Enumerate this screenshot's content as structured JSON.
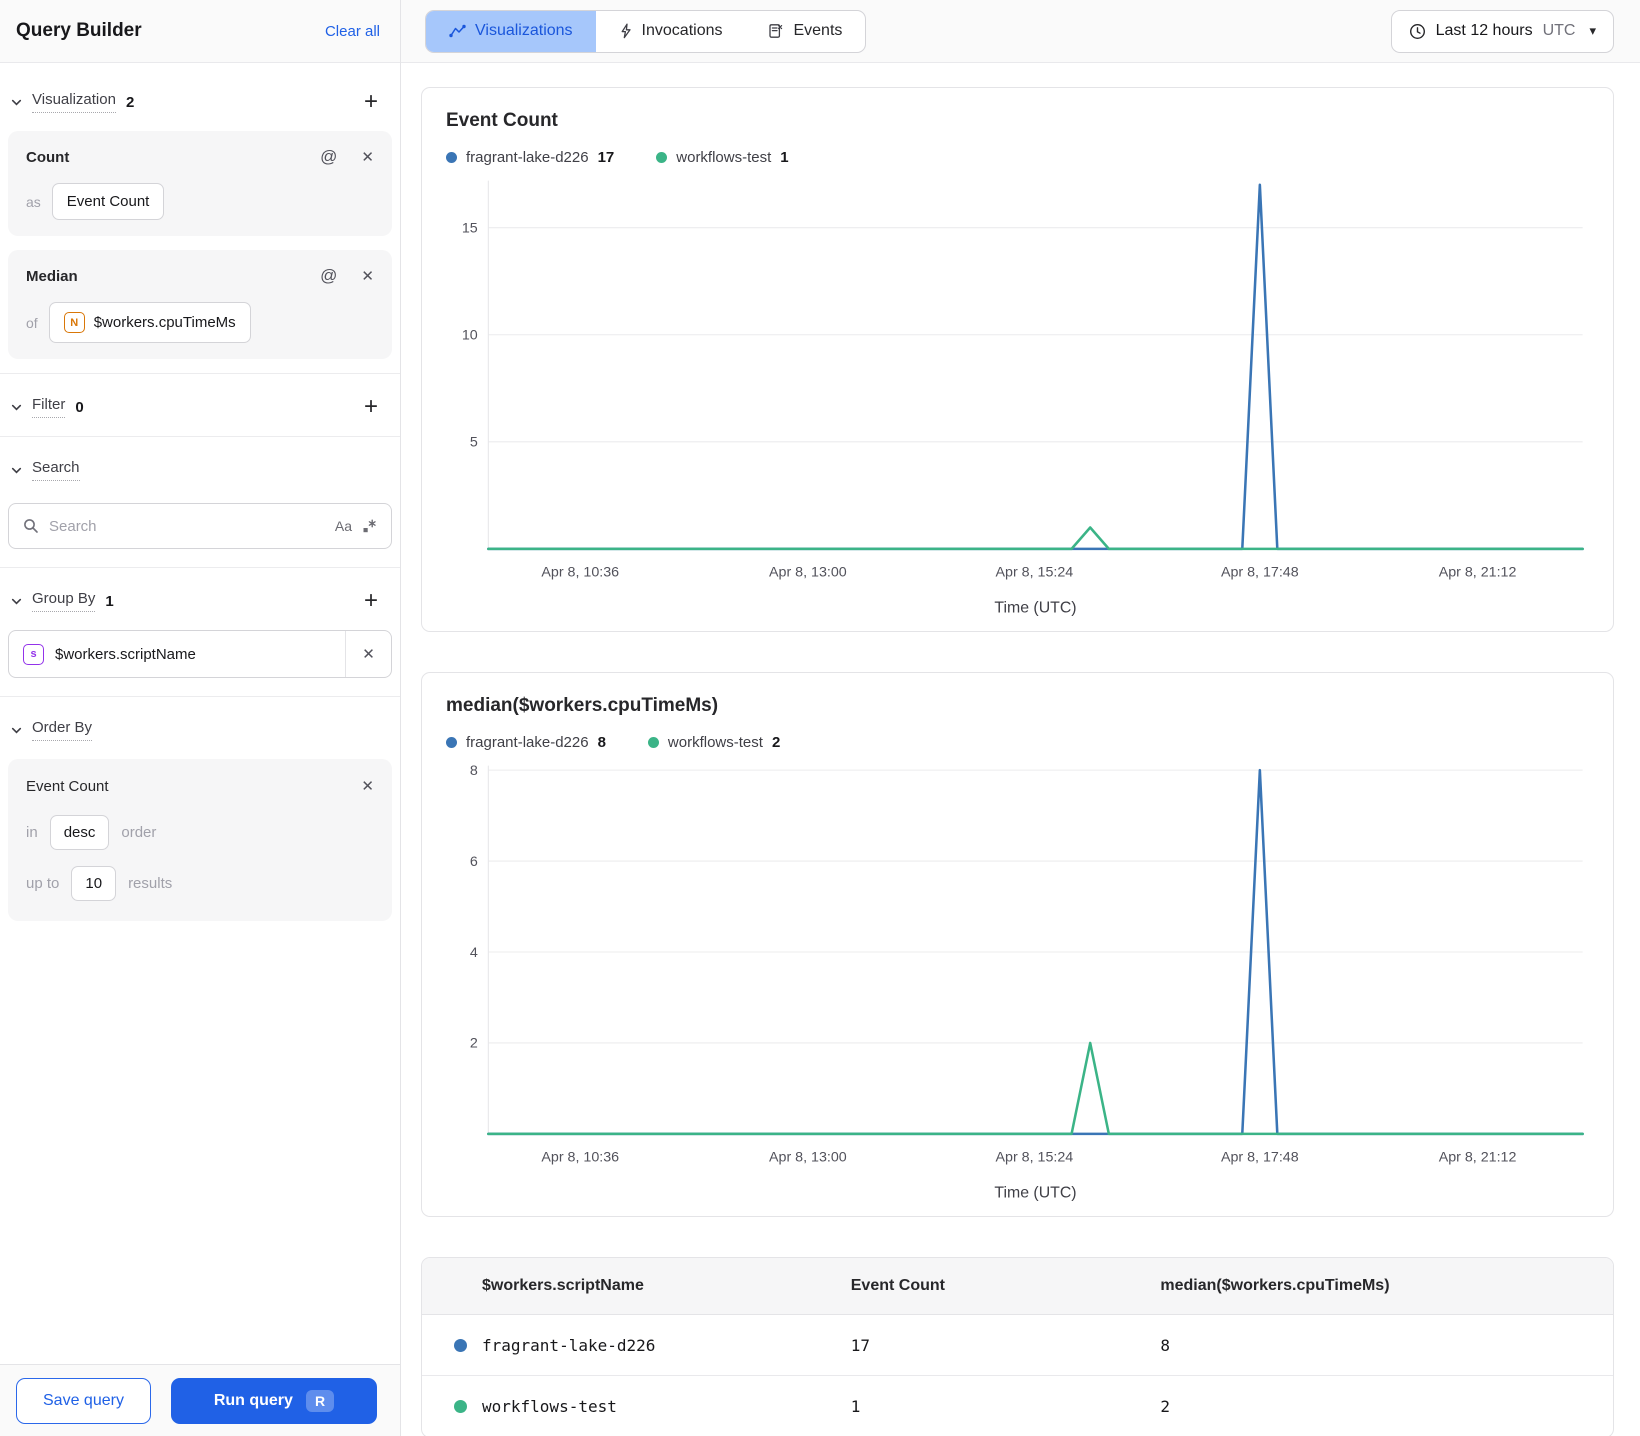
{
  "colors": {
    "primary_blue": "#2061e6",
    "active_tab_bg": "#a6c7fb",
    "active_tab_text": "#1a56db",
    "series_blue": "#3a75b5",
    "series_green": "#3bb487",
    "number_type_orange": "#d97708",
    "string_type_purple": "#9333ea"
  },
  "sidebar": {
    "title": "Query Builder",
    "clear_all": "Clear all",
    "visualization": {
      "label": "Visualization",
      "count": "2",
      "cards": [
        {
          "title": "Count",
          "prefix": "as",
          "value": "Event Count"
        },
        {
          "title": "Median",
          "prefix": "of",
          "value": "$workers.cpuTimeMs",
          "type_badge": "N"
        }
      ]
    },
    "filter": {
      "label": "Filter",
      "count": "0"
    },
    "search": {
      "label": "Search",
      "placeholder": "Search",
      "match_case_icon": "Aa"
    },
    "group_by": {
      "label": "Group By",
      "count": "1",
      "value": "$workers.scriptName",
      "type_badge": "s"
    },
    "order_by": {
      "label": "Order By",
      "field": "Event Count",
      "in_label": "in",
      "direction": "desc",
      "order_label": "order",
      "up_to_label": "up to",
      "limit": "10",
      "results_label": "results"
    },
    "footer": {
      "save": "Save query",
      "run": "Run query",
      "shortcut": "R"
    }
  },
  "topbar": {
    "tabs": [
      {
        "label": "Visualizations"
      },
      {
        "label": "Invocations"
      },
      {
        "label": "Events"
      }
    ],
    "time_range": {
      "label": "Last 12 hours",
      "timezone": "UTC"
    }
  },
  "chart_data": [
    {
      "type": "line",
      "title": "Event Count",
      "xlabel": "Time (UTC)",
      "x_ticks": [
        "Apr 8, 10:36",
        "Apr 8, 13:00",
        "Apr 8, 15:24",
        "Apr 8, 17:48",
        "Apr 8, 21:12"
      ],
      "x_tick_fracs": [
        0.084,
        0.292,
        0.499,
        0.705,
        0.904
      ],
      "y_ticks": [
        5,
        10,
        15
      ],
      "ylim": [
        0,
        17.2
      ],
      "grid": true,
      "legend_position": "top",
      "series": [
        {
          "name": "fragrant-lake-d226",
          "total": 17,
          "color": "#3a75b5",
          "points": [
            [
              0,
              0
            ],
            [
              0.689,
              0
            ],
            [
              0.705,
              17
            ],
            [
              0.721,
              0
            ],
            [
              1,
              0
            ]
          ]
        },
        {
          "name": "workflows-test",
          "total": 1,
          "color": "#3bb487",
          "points": [
            [
              0,
              0
            ],
            [
              0.533,
              0
            ],
            [
              0.55,
              1
            ],
            [
              0.567,
              0
            ],
            [
              1,
              0
            ]
          ]
        }
      ]
    },
    {
      "type": "line",
      "title": "median($workers.cpuTimeMs)",
      "xlabel": "Time (UTC)",
      "x_ticks": [
        "Apr 8, 10:36",
        "Apr 8, 13:00",
        "Apr 8, 15:24",
        "Apr 8, 17:48",
        "Apr 8, 21:12"
      ],
      "x_tick_fracs": [
        0.084,
        0.292,
        0.499,
        0.705,
        0.904
      ],
      "y_ticks": [
        2,
        4,
        6,
        8
      ],
      "ylim": [
        0,
        8.1
      ],
      "grid": true,
      "legend_position": "top",
      "series": [
        {
          "name": "fragrant-lake-d226",
          "total": 8,
          "color": "#3a75b5",
          "points": [
            [
              0,
              0
            ],
            [
              0.689,
              0
            ],
            [
              0.705,
              8
            ],
            [
              0.721,
              0
            ],
            [
              1,
              0
            ]
          ]
        },
        {
          "name": "workflows-test",
          "total": 2,
          "color": "#3bb487",
          "points": [
            [
              0,
              0
            ],
            [
              0.533,
              0
            ],
            [
              0.55,
              2
            ],
            [
              0.567,
              0
            ],
            [
              1,
              0
            ]
          ]
        }
      ]
    }
  ],
  "table": {
    "headers": [
      "$workers.scriptName",
      "Event Count",
      "median($workers.cpuTimeMs)"
    ],
    "rows": [
      {
        "name": "fragrant-lake-d226",
        "event_count": "17",
        "median": "8"
      },
      {
        "name": "workflows-test",
        "event_count": "1",
        "median": "2"
      }
    ]
  }
}
